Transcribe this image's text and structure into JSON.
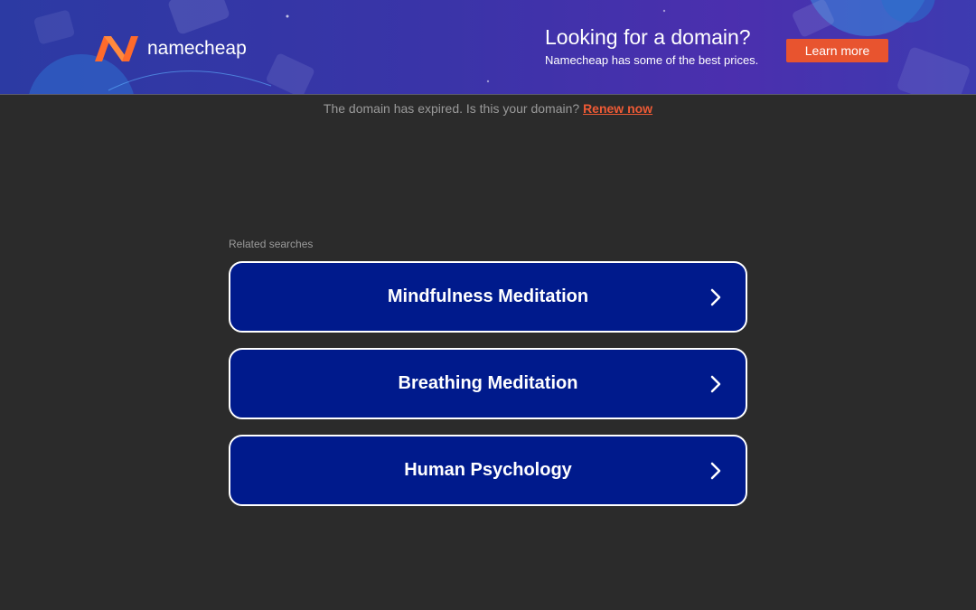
{
  "banner": {
    "brand_name": "namecheap",
    "promo_title": "Looking for a domain?",
    "promo_subtitle": "Namecheap has some of the best prices.",
    "learn_more_label": "Learn more"
  },
  "notice": {
    "text": "The domain has expired. Is this your domain?",
    "link_label": "Renew now"
  },
  "related": {
    "heading": "Related searches",
    "items": [
      {
        "label": "Mindfulness Meditation",
        "icon": "chevron-right-icon"
      },
      {
        "label": "Breathing Meditation",
        "icon": "chevron-right-icon"
      },
      {
        "label": "Human Psychology",
        "icon": "chevron-right-icon"
      }
    ]
  },
  "colors": {
    "page_bg": "#2b2b2b",
    "banner_bg": "#3a34a8",
    "accent_orange": "#e8542f",
    "result_button_bg": "#001a8c",
    "muted_text": "#9a9a9a"
  }
}
